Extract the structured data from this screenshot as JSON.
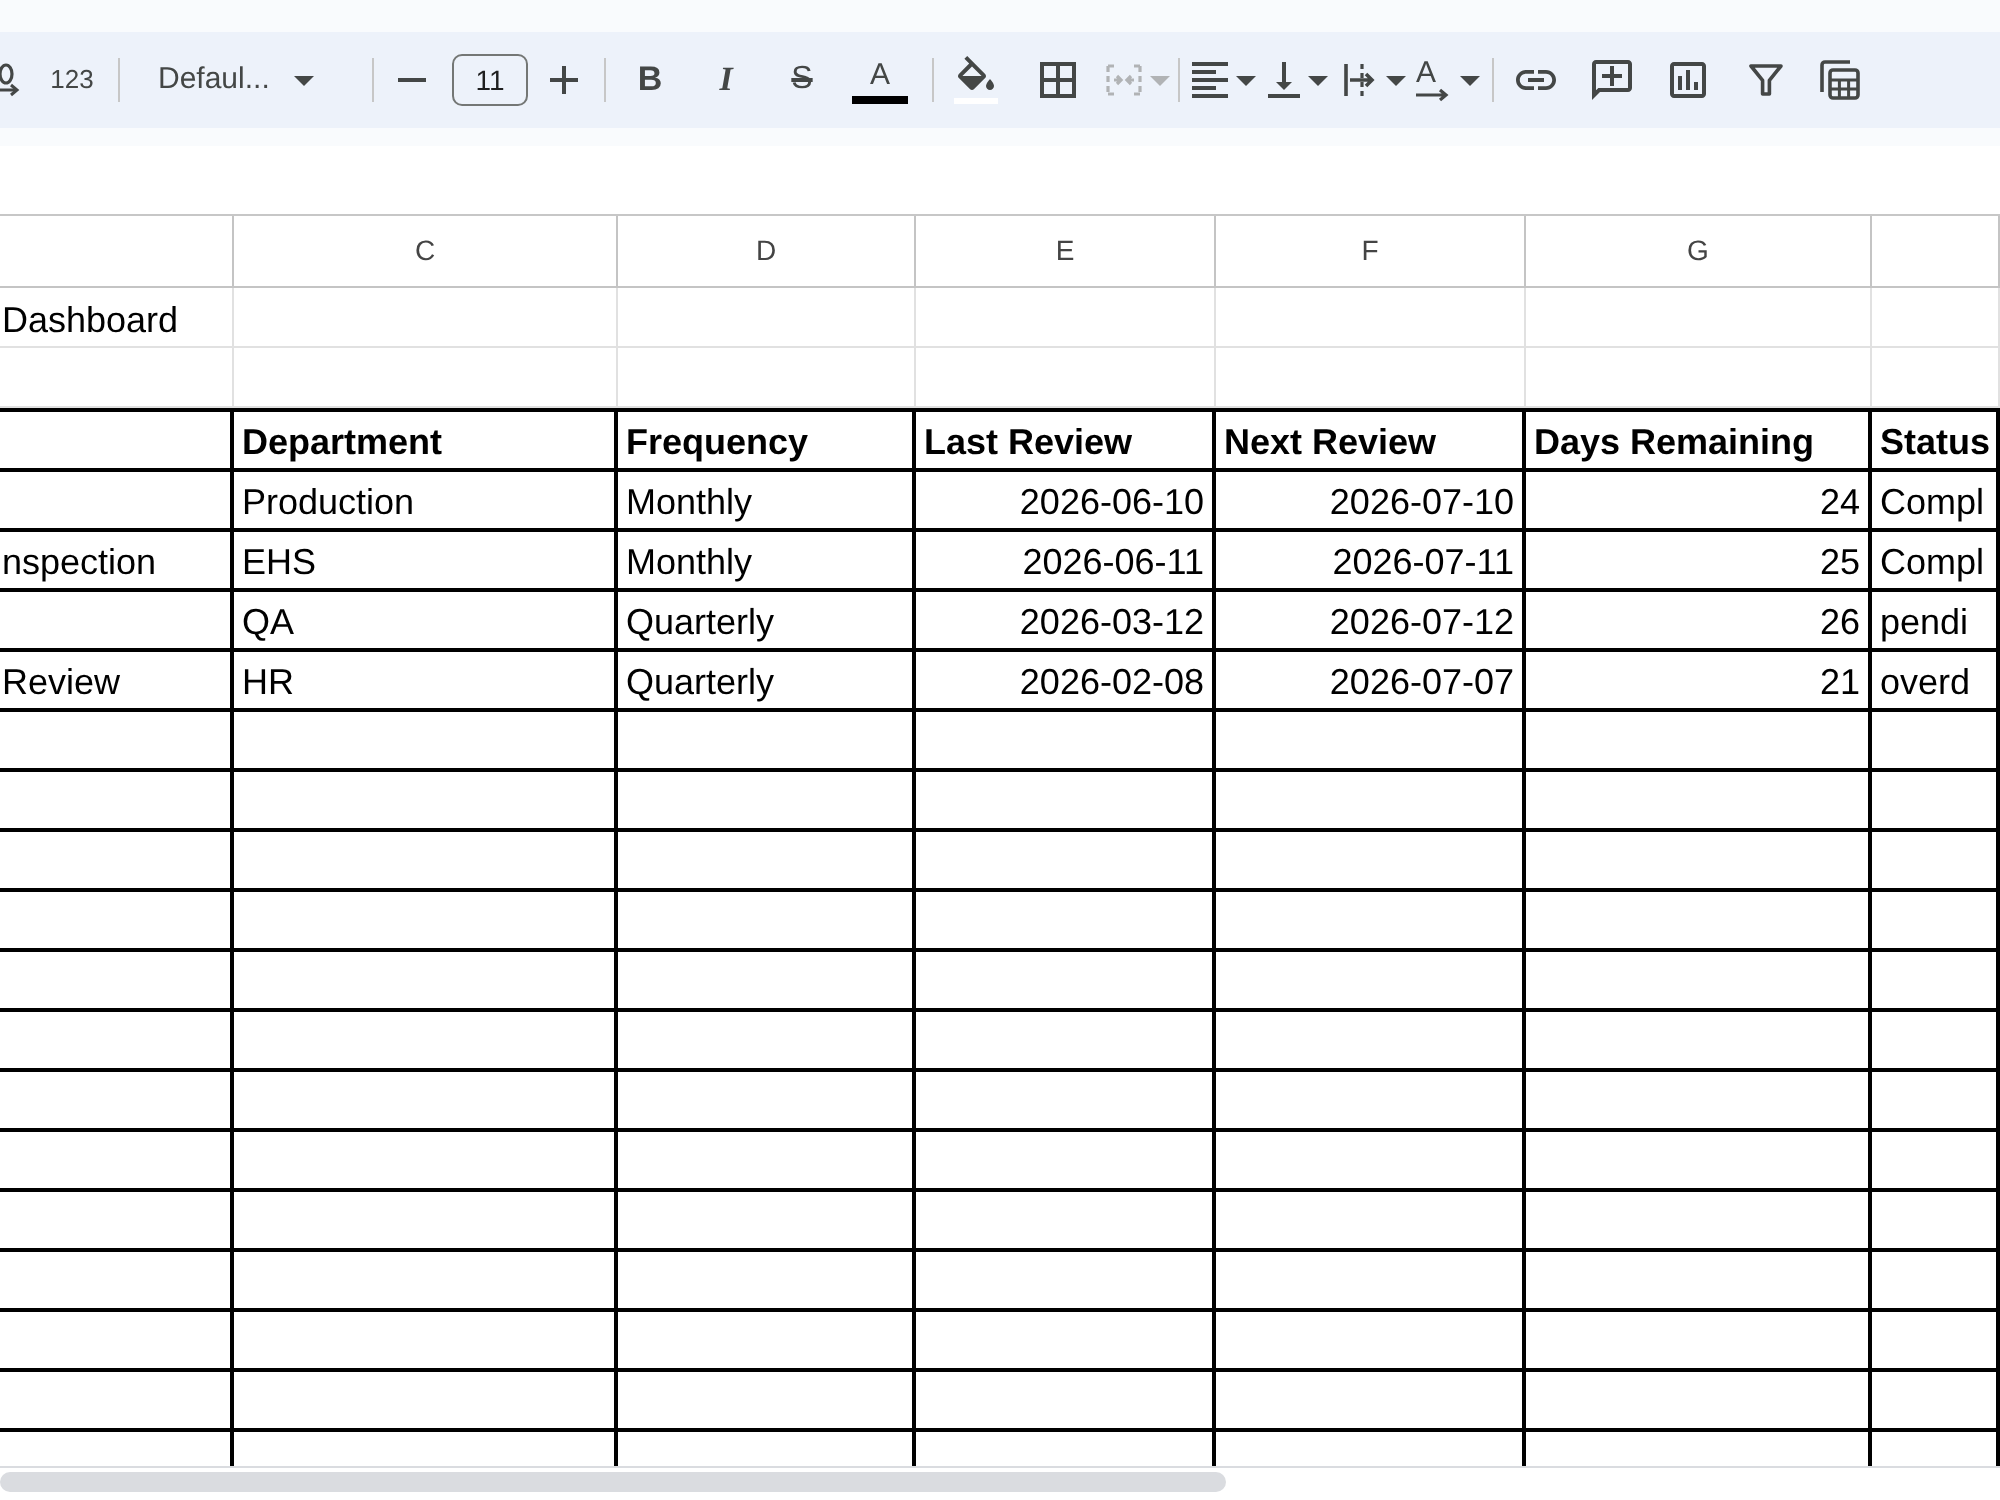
{
  "toolbar": {
    "number_format": "123",
    "font_menu": "Defaul...",
    "size_field": "11",
    "bold": "B",
    "italic": "I",
    "strikethrough": "S",
    "text_color": "A",
    "merge": {
      "disabled": true
    },
    "text_rotation": "A"
  },
  "sheet": {
    "column_headers": [
      "C",
      "D",
      "E",
      "F",
      "G"
    ],
    "rows": [
      {
        "kind": "plain",
        "cells": [
          "Dashboard"
        ]
      },
      {
        "kind": "plain"
      },
      {
        "kind": "header",
        "cells": [
          null,
          "Department",
          "Frequency",
          "Last Review",
          "Next Review",
          "Days Remaining",
          "Status"
        ]
      },
      {
        "kind": "data",
        "cells": [
          null,
          "Production",
          "Monthly",
          "2026-06-10",
          "2026-07-10",
          "24",
          "Compl"
        ]
      },
      {
        "kind": "data",
        "cells": [
          "nspection",
          "EHS",
          "Monthly",
          "2026-06-11",
          "2026-07-11",
          "25",
          "Compl"
        ]
      },
      {
        "kind": "data",
        "cells": [
          null,
          "QA",
          "Quarterly",
          "2026-03-12",
          "2026-07-12",
          "26",
          "pendi"
        ]
      },
      {
        "kind": "data",
        "cells": [
          "Review",
          "HR",
          "Quarterly",
          "2026-02-08",
          "2026-07-07",
          "21",
          "overd"
        ]
      },
      {
        "kind": "blank"
      },
      {
        "kind": "blank"
      },
      {
        "kind": "blank"
      },
      {
        "kind": "blank"
      },
      {
        "kind": "blank"
      },
      {
        "kind": "blank"
      },
      {
        "kind": "blank"
      },
      {
        "kind": "blank"
      },
      {
        "kind": "blank"
      },
      {
        "kind": "blank"
      },
      {
        "kind": "blank"
      },
      {
        "kind": "blank"
      },
      {
        "kind": "blank"
      }
    ]
  }
}
